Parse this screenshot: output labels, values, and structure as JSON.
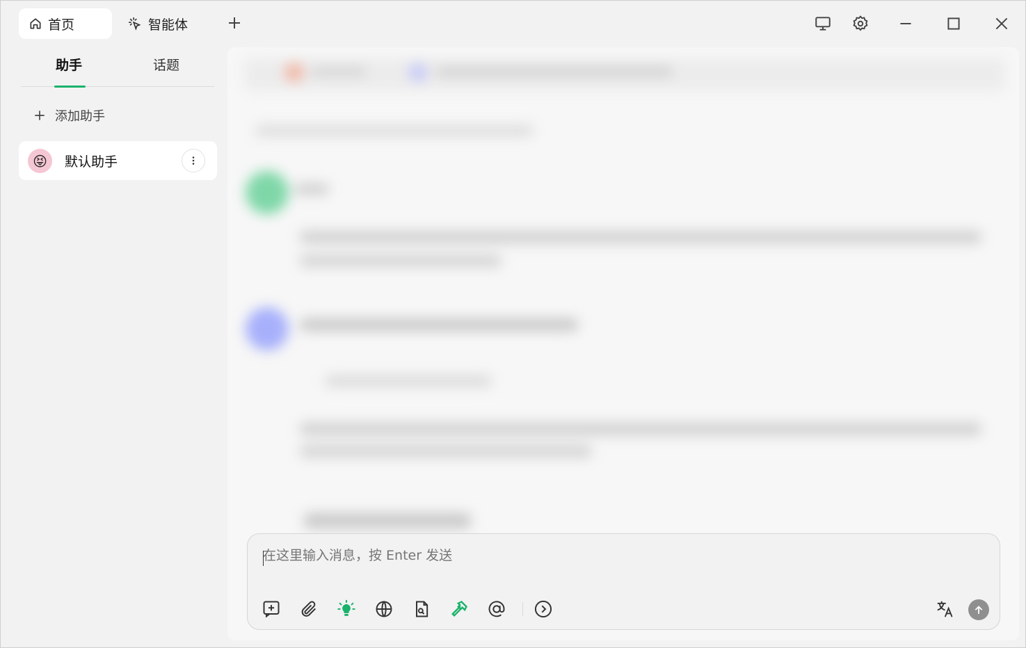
{
  "titlebar": {
    "tabs": [
      {
        "label": "首页",
        "icon": "home-icon"
      },
      {
        "label": "智能体",
        "icon": "sparkle-cursor-icon"
      }
    ],
    "add_tab_icon": "plus-icon",
    "controls": [
      "monitor-icon",
      "gear-icon",
      "minimize-icon",
      "maximize-icon",
      "close-icon"
    ]
  },
  "sidebar": {
    "tabs": [
      {
        "label": "助手",
        "active": true
      },
      {
        "label": "话题",
        "active": false
      }
    ],
    "add_assistant_label": "添加助手",
    "assistants": [
      {
        "name": "默认助手",
        "avatar": "😝"
      }
    ]
  },
  "composer": {
    "placeholder": "在这里输入消息，按 Enter 发送",
    "tools": [
      "new-topic-icon",
      "attachment-icon",
      "lightbulb-icon",
      "globe-icon",
      "file-search-icon",
      "hammer-icon",
      "at-icon",
      "chevron-right-circle-icon"
    ],
    "right_tools": [
      "translate-icon",
      "send-icon"
    ]
  },
  "colors": {
    "accent": "#18b26b",
    "send_button": "#8f8f8f"
  }
}
